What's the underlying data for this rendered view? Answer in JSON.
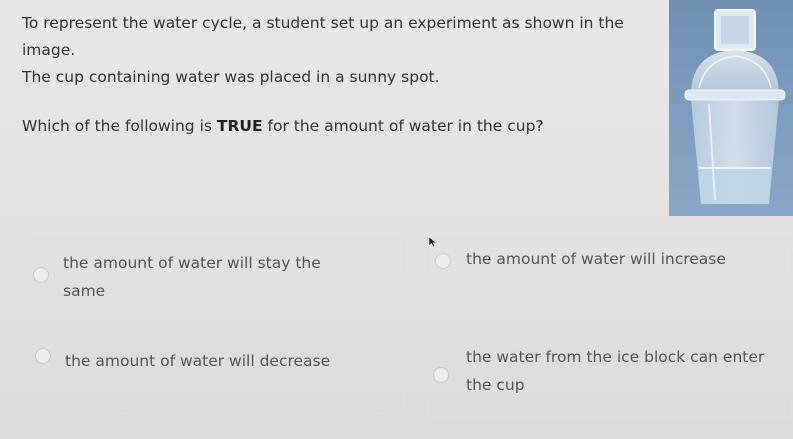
{
  "question": {
    "line1": "To represent the water cycle, a student set up an experiment as shown in the image.",
    "line2": "The cup containing water was placed in a sunny spot.",
    "prompt_pre": "Which of the following is ",
    "prompt_bold": "TRUE",
    "prompt_post": " for the amount of water in the cup?"
  },
  "figure": {
    "icon": "ice-block-on-dome-cup-image"
  },
  "options": [
    {
      "id": "a",
      "label_line1": "the amount of water will stay the",
      "label_line2": "same"
    },
    {
      "id": "b",
      "label_line1": "the amount of water will increase",
      "label_line2": ""
    },
    {
      "id": "c",
      "label_line1": "the amount of water will decrease",
      "label_line2": ""
    },
    {
      "id": "d",
      "label_line1": "the water from the ice block can enter",
      "label_line2": "the cup"
    }
  ]
}
